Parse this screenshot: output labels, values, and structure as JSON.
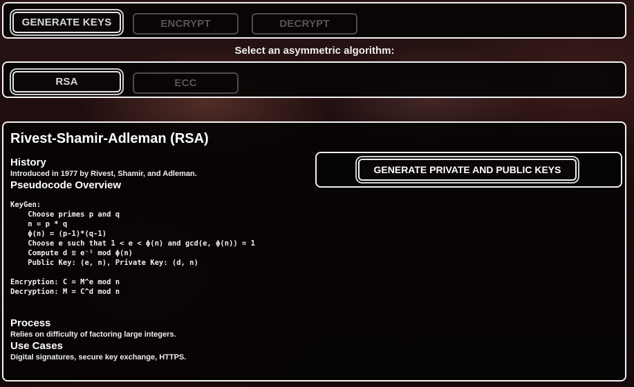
{
  "top_tabs": {
    "generate_keys": "GENERATE KEYS",
    "encrypt": "ENCRYPT",
    "decrypt": "DECRYPT"
  },
  "select_label": "Select an asymmetric algorithm:",
  "algo_tabs": {
    "rsa": "RSA",
    "ecc": "ECC"
  },
  "main": {
    "title": "Rivest-Shamir-Adleman (RSA)",
    "history_heading": "History",
    "history_text": "Introduced in 1977 by Rivest, Shamir, and Adleman.",
    "pseudocode_heading": "Pseudocode Overview",
    "pseudocode": "KeyGen:\n    Choose primes p and q\n    n = p * q\n    ϕ(n) = (p-1)*(q-1)\n    Choose e such that 1 < e < ϕ(n) and gcd(e, ϕ(n)) = 1\n    Compute d ≡ e⁻¹ mod ϕ(n)\n    Public Key: (e, n), Private Key: (d, n)\n\nEncryption: C = M^e mod n\nDecryption: M = C^d mod n",
    "process_heading": "Process",
    "process_text": "Relies on difficulty of factoring large integers.",
    "use_cases_heading": "Use Cases",
    "use_cases_text": "Digital signatures, secure key exchange, HTTPS.",
    "generate_button": "GENERATE PRIVATE AND PUBLIC KEYS"
  }
}
